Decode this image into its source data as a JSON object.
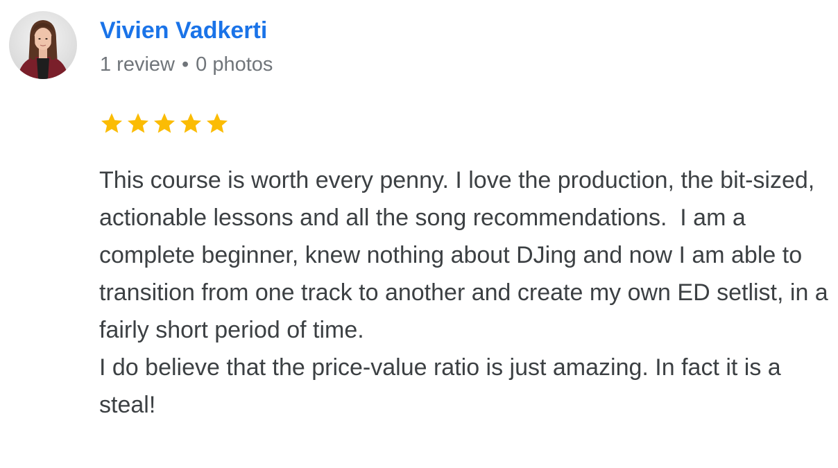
{
  "reviewer": {
    "name": "Vivien Vadkerti",
    "review_count": "1 review",
    "separator": "•",
    "photo_count": "0 photos",
    "avatar": "avatar-photo"
  },
  "rating": {
    "stars": 5,
    "max_stars": 5,
    "icon": "star-icon",
    "color": "#fbbc04"
  },
  "review": {
    "paragraphs": [
      "This course is worth every penny. I love the production, the bit-sized, actionable lessons and all the song recommendations.  I am a complete beginner, knew nothing about DJing and now I am able to transition from one track to another and create my own ED setlist, in a fairly short period of time.",
      "I do believe that the price-value ratio is just amazing. In fact it is a steal!"
    ]
  },
  "colors": {
    "name": "#1a73e8",
    "meta": "#70757a",
    "text": "#3c4043",
    "star": "#fbbc04"
  }
}
